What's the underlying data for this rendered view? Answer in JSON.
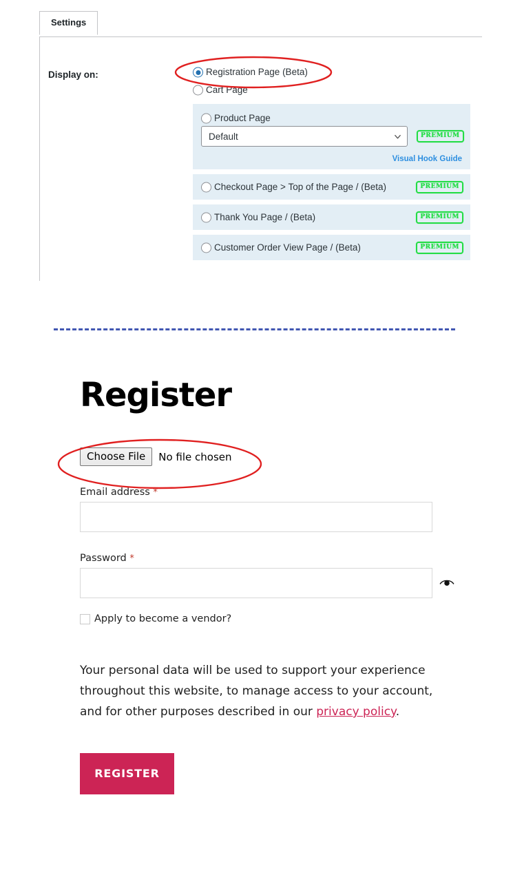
{
  "settings_panel": {
    "tab_label": "Settings",
    "display_label": "Display on:",
    "options": [
      {
        "id": "registration-page",
        "label": "Registration Page (Beta)",
        "selected": true,
        "premium": false,
        "shaded": false
      },
      {
        "id": "cart-page",
        "label": "Cart Page",
        "selected": false,
        "premium": false,
        "shaded": false
      }
    ],
    "product_block": {
      "option_label": "Product Page",
      "select_value": "Default",
      "premium_badge": "PREMIUM",
      "hook_link": "Visual Hook Guide",
      "chevron_icon": "chevron-down-icon"
    },
    "premium_options": [
      {
        "id": "checkout-page",
        "label": "Checkout Page > Top of the Page / (Beta)",
        "badge": "PREMIUM"
      },
      {
        "id": "thank-you-page",
        "label": "Thank You Page / (Beta)",
        "badge": "PREMIUM"
      },
      {
        "id": "customer-order-view-page",
        "label": "Customer Order View Page / (Beta)",
        "badge": "PREMIUM"
      }
    ]
  },
  "register_form": {
    "title": "Register",
    "file_upload": {
      "button_label": "Choose File",
      "status_text": "No file chosen"
    },
    "fields": [
      {
        "id": "email",
        "label": "Email address",
        "required_mark": "*",
        "value": ""
      },
      {
        "id": "password",
        "label": "Password",
        "required_mark": "*",
        "value": "",
        "toggle_icon": "eye-icon"
      }
    ],
    "vendor_checkbox": {
      "label": "Apply to become a vendor?",
      "checked": false
    },
    "privacy_notice": {
      "text_before": "Your personal data will be used to support your experience throughout this website, to manage access to your account, and for other purposes described in our ",
      "link_text": "privacy policy",
      "text_after": "."
    },
    "submit_label": "REGISTER"
  },
  "annotations": {
    "highlight_1": "registration-page-option",
    "highlight_2": "choose-file-control"
  },
  "colors": {
    "accent_pink": "#cc2455",
    "premium_green": "#22dd44",
    "link_blue": "#2e8fe0",
    "radio_blue": "#2271b1",
    "shade_blue": "#e3eef5",
    "divider_blue": "#4257b2",
    "annotation_red": "#e02020"
  }
}
